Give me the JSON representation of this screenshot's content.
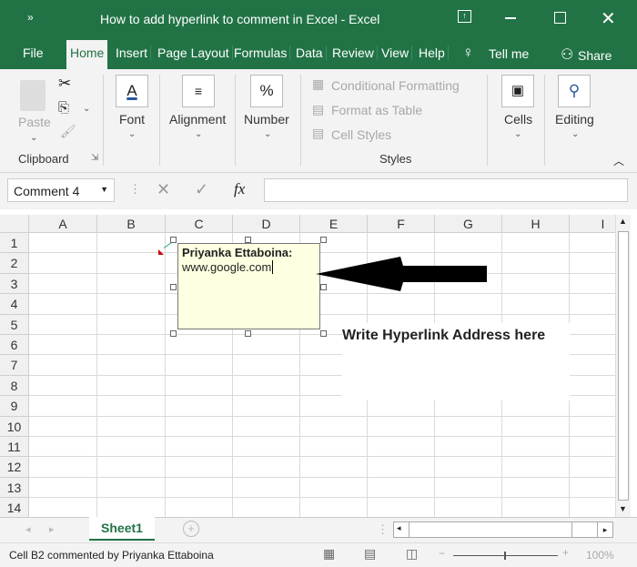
{
  "window": {
    "title": "How to add hyperlink to comment in Excel  -  Excel",
    "quick_access": "»"
  },
  "tabs": [
    {
      "label": "File"
    },
    {
      "label": "Home"
    },
    {
      "label": "Insert"
    },
    {
      "label": "Page Layout"
    },
    {
      "label": "Formulas"
    },
    {
      "label": "Data"
    },
    {
      "label": "Review"
    },
    {
      "label": "View"
    },
    {
      "label": "Help"
    }
  ],
  "tell_me": "Tell me",
  "share": "Share",
  "ribbon": {
    "paste": "Paste",
    "clipboard": "Clipboard",
    "font": "Font",
    "alignment": "Alignment",
    "number": "Number",
    "conditional_formatting": "Conditional Formatting",
    "format_as_table": "Format as Table",
    "cell_styles": "Cell Styles",
    "styles": "Styles",
    "cells": "Cells",
    "editing": "Editing"
  },
  "formula_bar": {
    "name_box": "Comment 4",
    "fx": "fx",
    "value": ""
  },
  "columns": [
    "A",
    "B",
    "C",
    "D",
    "E",
    "F",
    "G",
    "H",
    "I"
  ],
  "rows": [
    "1",
    "2",
    "3",
    "4",
    "5",
    "6",
    "7",
    "8",
    "9",
    "10",
    "11",
    "12",
    "13",
    "14"
  ],
  "comment": {
    "author": "Priyanka Ettaboina:",
    "text": "www.google.com"
  },
  "annotation": "Write Hyperlink Address here",
  "sheet_tabs": [
    {
      "label": "Sheet1"
    }
  ],
  "status": {
    "text": "Cell B2 commented by Priyanka Ettaboina",
    "zoom": "100%"
  },
  "colors": {
    "excel_green": "#217346",
    "comment_bg": "#ffffe1"
  }
}
